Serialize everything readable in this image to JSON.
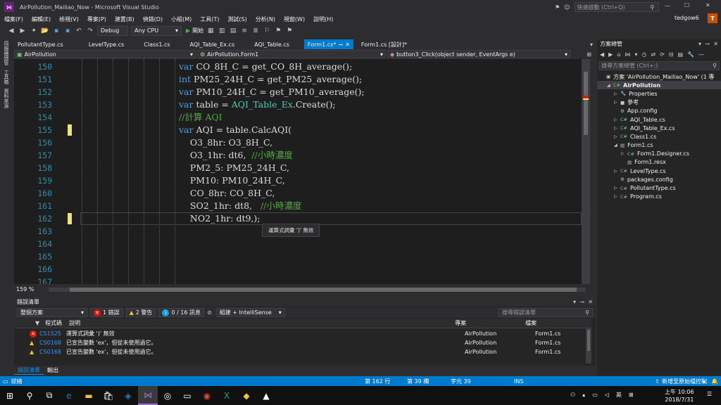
{
  "window": {
    "title": "AirPollution_Mailiao_Now - Microsoft Visual Studio",
    "quick_launch": "快速啟動 (Ctrl+Q)",
    "user": "tedgow6",
    "user_initial": "T"
  },
  "menu": [
    "檔案(F)",
    "編輯(E)",
    "檢視(V)",
    "專案(P)",
    "建置(B)",
    "偵錯(D)",
    "小組(M)",
    "工具(T)",
    "測試(S)",
    "分析(N)",
    "視窗(W)",
    "說明(H)"
  ],
  "toolbar": {
    "config": "Debug",
    "platform": "Any CPU",
    "start": "開始"
  },
  "left_tabs": [
    "伺服器總管",
    "工具箱",
    "資料來源"
  ],
  "tabs": [
    "PollutantType.cs",
    "LevelType.cs",
    "Class1.cs",
    "AQI_Table_Ex.cs",
    "AQI_Table.cs",
    "Form1.cs*",
    "Form1.cs [設計]*"
  ],
  "nav": {
    "project": "AirPollution",
    "class": "AirPollution.Form1",
    "member": "button3_Click(object sender, EventArgs e)"
  },
  "code": {
    "line_numbers": [
      "150",
      "151",
      "152",
      "153",
      "154",
      "155",
      "156",
      "157",
      "158",
      "159",
      "160",
      "161",
      "162",
      "163",
      "164",
      "165",
      "166",
      "167"
    ],
    "lines": [
      [
        {
          "t": "var",
          "c": "kw"
        },
        {
          "t": " CO_8H_C = get_CO_8H_average();"
        }
      ],
      [
        {
          "t": "int",
          "c": "kw"
        },
        {
          "t": " PM25_24H_C = get_PM25_average();"
        }
      ],
      [
        {
          "t": "var",
          "c": "kw"
        },
        {
          "t": " PM10_24H_C = get_PM10_average();"
        }
      ],
      [
        {
          "t": "var",
          "c": "kw"
        },
        {
          "t": " table = "
        },
        {
          "t": "AQI_Table_Ex",
          "c": "ty"
        },
        {
          "t": ".Create();"
        }
      ],
      [
        {
          "t": "//計算 AQI",
          "c": "cm"
        }
      ],
      [
        {
          "t": "var",
          "c": "kw"
        },
        {
          "t": " AQI = table.CalcAQI("
        }
      ],
      [
        {
          "t": "    O3_8hr: O3_8H_C,"
        }
      ],
      [
        {
          "t": "    O3_1hr: dt6,  "
        },
        {
          "t": "//小時濃度",
          "c": "cm"
        }
      ],
      [
        {
          "t": "    PM2_5: PM25_24H_C,"
        }
      ],
      [
        {
          "t": "    PM10: PM10_24H_C,"
        }
      ],
      [
        {
          "t": "    CO_8hr: CO_8H_C,"
        }
      ],
      [
        {
          "t": "    SO2_1hr: dt8,   "
        },
        {
          "t": "//小時濃度",
          "c": "cm"
        }
      ],
      [
        {
          "t": "    NO2_1hr: dt9,);"
        }
      ]
    ],
    "tooltip": "運算式詞彙 ')' 無效",
    "zoom": "159 %"
  },
  "error_list": {
    "title": "錯誤清單",
    "scope": "整個方案",
    "errors": "1 錯誤",
    "warnings": "2 警告",
    "messages": "0 / 16 訊息",
    "filter": "組建 + IntelliSense",
    "search": "搜尋錯誤清單",
    "headers": {
      "code": "程式碼",
      "desc": "說明",
      "project": "專案",
      "file": "檔案"
    },
    "rows": [
      {
        "type": "error",
        "code": "CS1525",
        "desc": "運算式詞彙 ')' 無效",
        "project": "AirPollution",
        "file": "Form1.cs"
      },
      {
        "type": "warning",
        "code": "CS0168",
        "desc": "已宣告變數 'ex'，但從未使用過它。",
        "project": "AirPollution",
        "file": "Form1.cs"
      },
      {
        "type": "warning",
        "code": "CS0168",
        "desc": "已宣告變數 'ex'，但從未使用過它。",
        "project": "AirPollution",
        "file": "Form1.cs"
      }
    ],
    "bottom_tabs": [
      "錯誤清單",
      "輸出"
    ]
  },
  "solution": {
    "title": "方案總管",
    "search": "搜尋方案總管 (Ctrl+;)",
    "items": [
      {
        "label": "方案 'AirPollution_Mailiao_Now' (1 專",
        "indent": 0,
        "icon": "▣"
      },
      {
        "label": "AirPollution",
        "indent": 1,
        "icon": "C#",
        "bold": true
      },
      {
        "label": "Properties",
        "indent": 2,
        "icon": "🔧"
      },
      {
        "label": "參考",
        "indent": 2,
        "icon": "■"
      },
      {
        "label": "App.config",
        "indent": 2,
        "icon": "⚙"
      },
      {
        "label": "AQI_Table.cs",
        "indent": 2,
        "icon": "C#"
      },
      {
        "label": "AQI_Table_Ex.cs",
        "indent": 2,
        "icon": "C#"
      },
      {
        "label": "Class1.cs",
        "indent": 2,
        "icon": "C#"
      },
      {
        "label": "Form1.cs",
        "indent": 2,
        "icon": "▤"
      },
      {
        "label": "Form1.Designer.cs",
        "indent": 3,
        "icon": "C#"
      },
      {
        "label": "Form1.resx",
        "indent": 3,
        "icon": "▤"
      },
      {
        "label": "LevelType.cs",
        "indent": 2,
        "icon": "C#"
      },
      {
        "label": "packages.config",
        "indent": 2,
        "icon": "⚙"
      },
      {
        "label": "PollutantType.cs",
        "indent": 2,
        "icon": "C#"
      },
      {
        "label": "Program.cs",
        "indent": 2,
        "icon": "C#"
      }
    ]
  },
  "status": {
    "ready": "就緒",
    "line": "第 162 行",
    "col": "第 39 欄",
    "ch": "字元 39",
    "ins": "INS",
    "source_control": "新增至原始檔控制"
  },
  "taskbar": {
    "time": "上午 10:06",
    "date": "2018/7/31",
    "ime": "英"
  },
  "colors": {
    "accent": "#007acc",
    "keyword": "#569cd6",
    "type": "#4ec9b0",
    "comment": "#57a64a",
    "line_number": "#2b91af"
  }
}
